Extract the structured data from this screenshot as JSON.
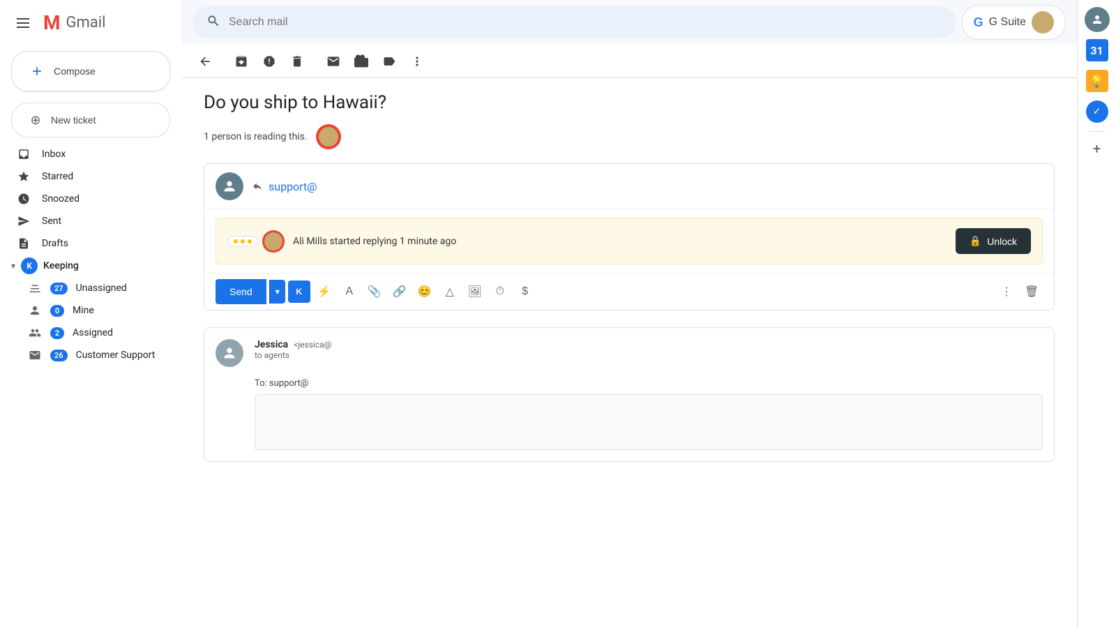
{
  "sidebar": {
    "hamburger_label": "Menu",
    "gmail_logo": "Gmail",
    "compose_label": "Compose",
    "new_ticket_label": "New ticket",
    "nav": [
      {
        "id": "inbox",
        "icon": "☐",
        "label": "Inbox",
        "badge": null
      },
      {
        "id": "starred",
        "icon": "★",
        "label": "Starred",
        "badge": null
      },
      {
        "id": "snoozed",
        "icon": "⏰",
        "label": "Snoozed",
        "badge": null
      },
      {
        "id": "sent",
        "icon": "▶",
        "label": "Sent",
        "badge": null
      },
      {
        "id": "drafts",
        "icon": "📄",
        "label": "Drafts",
        "badge": null
      }
    ],
    "keeping_section": "Keeping",
    "sub_nav": [
      {
        "id": "unassigned",
        "icon": "≡",
        "label": "Unassigned",
        "badge": "27"
      },
      {
        "id": "mine",
        "icon": "👤",
        "label": "Mine",
        "badge": "0"
      },
      {
        "id": "assigned",
        "icon": "👥",
        "label": "Assigned",
        "badge": "2"
      },
      {
        "id": "customer-support",
        "icon": "✉",
        "label": "Customer Support",
        "badge": "26"
      }
    ]
  },
  "topbar": {
    "search_placeholder": "Search mail",
    "gsuite_label": "G Suite",
    "user_initial": ""
  },
  "toolbar": {
    "back_label": "Back",
    "archive_label": "Archive",
    "report_spam_label": "Report spam",
    "delete_label": "Delete",
    "mark_unread_label": "Mark as unread",
    "move_label": "Move",
    "label_label": "Label",
    "more_label": "More"
  },
  "email": {
    "subject": "Do you ship to Hawaii?",
    "reading_notice": "1 person is reading this.",
    "reply": {
      "to_label": "support@",
      "reply_icon": "↩"
    },
    "typing_notice": {
      "text": "Ali Mills started replying 1 minute ago",
      "unlock_label": "Unlock",
      "lock_icon": "🔒"
    },
    "toolbar": {
      "send_label": "Send",
      "dropdown_label": "▾"
    },
    "sender": {
      "name": "Jessica",
      "email": "<jessica@",
      "to": "to agents",
      "to_support": "To: support@"
    }
  },
  "right_sidebar": {
    "calendar_label": "31",
    "keep_icon": "💡",
    "tasks_icon": "✓",
    "add_icon": "+"
  }
}
